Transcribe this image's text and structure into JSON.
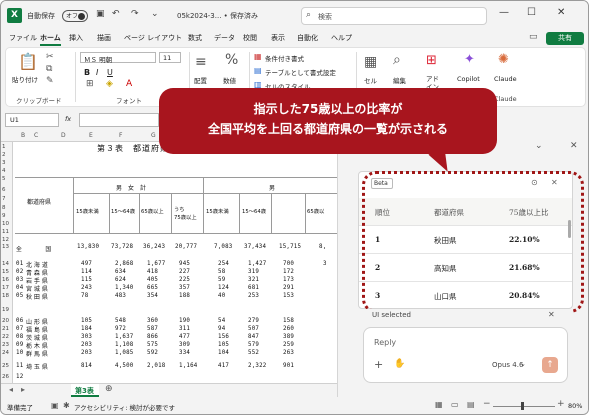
{
  "titlebar": {
    "autosave_label": "自動保存",
    "autosave_state": "オフ",
    "file_name": "05k2024-3... • 保存済み",
    "search_placeholder": "検索"
  },
  "tabs": [
    "ファイル",
    "ホーム",
    "挿入",
    "描画",
    "ページ レイアウト",
    "数式",
    "データ",
    "校閲",
    "表示",
    "自動化",
    "ヘルプ"
  ],
  "active_tab": "ホーム",
  "share_label": "共有",
  "ribbon": {
    "paste_label": "貼り付け",
    "clipboard_group": "クリップボード",
    "font_name": "ＭＳ 明朝",
    "font_size": "11",
    "bold": "B",
    "italic": "I",
    "underline": "U",
    "font_group": "フォント",
    "align_label": "配置",
    "number_label": "数値",
    "cond_format": "条件付き書式",
    "table_format": "テーブルとして書式設定",
    "cell_style": "セルのスタイル",
    "cells_label": "セル",
    "edit_label": "編集",
    "addin_label1": "アド",
    "addin_label2": "イン",
    "copilot_label": "Copilot",
    "claude_label": "Claude",
    "claude_group": "Claude"
  },
  "formula_bar": {
    "name_box": "U1",
    "fx": "fx"
  },
  "grid": {
    "columns": [
      "A",
      "B",
      "C",
      "D",
      "E",
      "F",
      "G",
      "H",
      "I",
      "J",
      "K",
      "L",
      "M"
    ],
    "row_numbers": [
      "1",
      "2",
      "3",
      "4",
      "5",
      "6",
      "7",
      "8",
      "9",
      "10",
      "11",
      "12",
      "13",
      "14",
      "15",
      "16",
      "17",
      "18",
      "19",
      "20",
      "21",
      "22",
      "23",
      "24",
      "25",
      "26"
    ],
    "title": "第３表　都道府県、年",
    "header_left": "都道府県",
    "group_total": "男　女　計",
    "group_male": "男",
    "sub_headers": [
      "15歳未満",
      "15～64歳",
      "65歳以上",
      "うち",
      "75歳以上",
      "15歳未満",
      "15～64歳",
      "65歳以"
    ],
    "national_label": "全　　国",
    "national_values": [
      "13,830",
      "73,728",
      "36,243",
      "20,777",
      "7,083",
      "37,434",
      "15,715",
      "8,"
    ],
    "block1": [
      {
        "no": "01",
        "name": "北 海 道",
        "vals": [
          "497",
          "2,868",
          "1,677",
          "945",
          "254",
          "1,427",
          "700",
          "3"
        ]
      },
      {
        "no": "02",
        "name": "青 森 県",
        "vals": [
          "114",
          "634",
          "418",
          "227",
          "58",
          "319",
          "172",
          ""
        ]
      },
      {
        "no": "03",
        "name": "岩 手 県",
        "vals": [
          "115",
          "624",
          "405",
          "225",
          "59",
          "321",
          "173",
          ""
        ]
      },
      {
        "no": "04",
        "name": "宮 城 県",
        "vals": [
          "243",
          "1,340",
          "665",
          "357",
          "124",
          "681",
          "291",
          ""
        ]
      },
      {
        "no": "05",
        "name": "秋 田 県",
        "vals": [
          "78",
          "483",
          "354",
          "188",
          "40",
          "253",
          "153",
          ""
        ]
      }
    ],
    "block2": [
      {
        "no": "06",
        "name": "山 形 県",
        "vals": [
          "105",
          "548",
          "360",
          "190",
          "54",
          "279",
          "158",
          ""
        ]
      },
      {
        "no": "07",
        "name": "福 島 県",
        "vals": [
          "184",
          "972",
          "587",
          "311",
          "94",
          "507",
          "260",
          ""
        ]
      },
      {
        "no": "08",
        "name": "茨 城 県",
        "vals": [
          "303",
          "1,637",
          "866",
          "477",
          "156",
          "847",
          "389",
          ""
        ]
      },
      {
        "no": "09",
        "name": "栃 木 県",
        "vals": [
          "203",
          "1,108",
          "575",
          "309",
          "105",
          "579",
          "259",
          ""
        ]
      },
      {
        "no": "10",
        "name": "群 馬 県",
        "vals": [
          "203",
          "1,085",
          "592",
          "334",
          "104",
          "552",
          "263",
          ""
        ]
      }
    ],
    "block3": [
      {
        "no": "11",
        "name": "埼 玉 県",
        "vals": [
          "814",
          "4,500",
          "2,018",
          "1,164",
          "417",
          "2,322",
          "901",
          ""
        ]
      }
    ],
    "row26_partial": "12",
    "sheet_tab": "第3表"
  },
  "status": {
    "ready": "準備完了",
    "accessibility": "アクセシビリティ: 検討が必要です",
    "zoom": "80%"
  },
  "panel": {
    "beta_label": "Beta",
    "table_headers": [
      "順位",
      "都道府県",
      "75歳以上比"
    ],
    "rows": [
      {
        "rank": "1",
        "pref": "秋田県",
        "ratio": "22.10%"
      },
      {
        "rank": "2",
        "pref": "高知県",
        "ratio": "21.68%"
      },
      {
        "rank": "3",
        "pref": "山口県",
        "ratio": "20.84%"
      }
    ],
    "ui_selected": "UI selected",
    "reply_placeholder": "Reply",
    "model_label": "Opus 4.6"
  },
  "callout": {
    "line1": "指示した75歳以上の比率が",
    "line2": "全国平均を上回る都道府県の一覧が示される",
    "color": "#a8151e"
  }
}
